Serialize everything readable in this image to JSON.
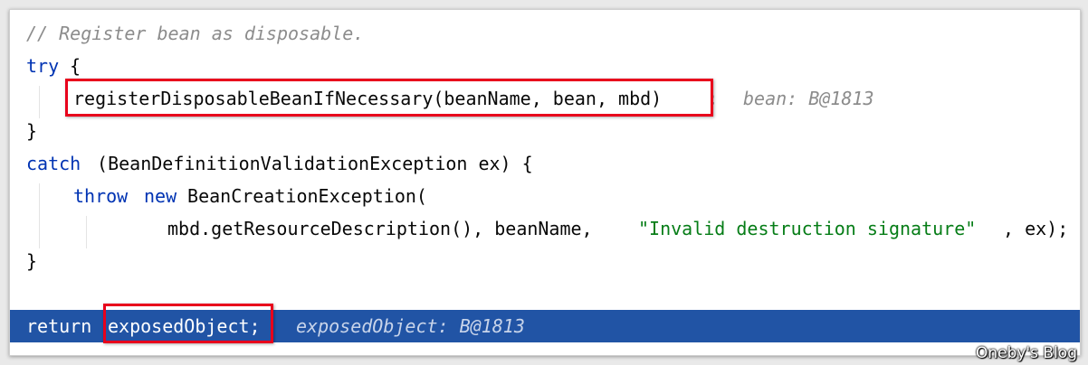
{
  "editor": {
    "line1": {
      "comment": "// Register bean as disposable."
    },
    "line2": {
      "kw_try": "try",
      "brace": " {"
    },
    "line3": {
      "call": "registerDisposableBeanIfNecessary(beanName, bean, mbd)",
      "semi": ";",
      "hint": "bean: B@1813"
    },
    "line4": {
      "brace": "}"
    },
    "line5": {
      "kw_catch": "catch",
      "rest": " (BeanDefinitionValidationException ex) {"
    },
    "line6": {
      "kw_throw": "throw",
      "sp": " ",
      "kw_new": "new",
      "rest": " BeanCreationException("
    },
    "line7": {
      "pre": "mbd.getResourceDescription(), beanName, ",
      "string": "\"Invalid destruction signature\"",
      "post": ", ex);"
    },
    "line8": {
      "brace": "}"
    },
    "line10": {
      "kw_return": "return",
      "var": "exposedObject;",
      "hint": "exposedObject: B@1813"
    }
  },
  "watermark": "Oneby's Blog",
  "colors": {
    "keyword": "#0033b3",
    "comment": "#8c8c8c",
    "string": "#067d17",
    "execution_line": "#2154a5",
    "highlight_box": "#e8001c"
  }
}
